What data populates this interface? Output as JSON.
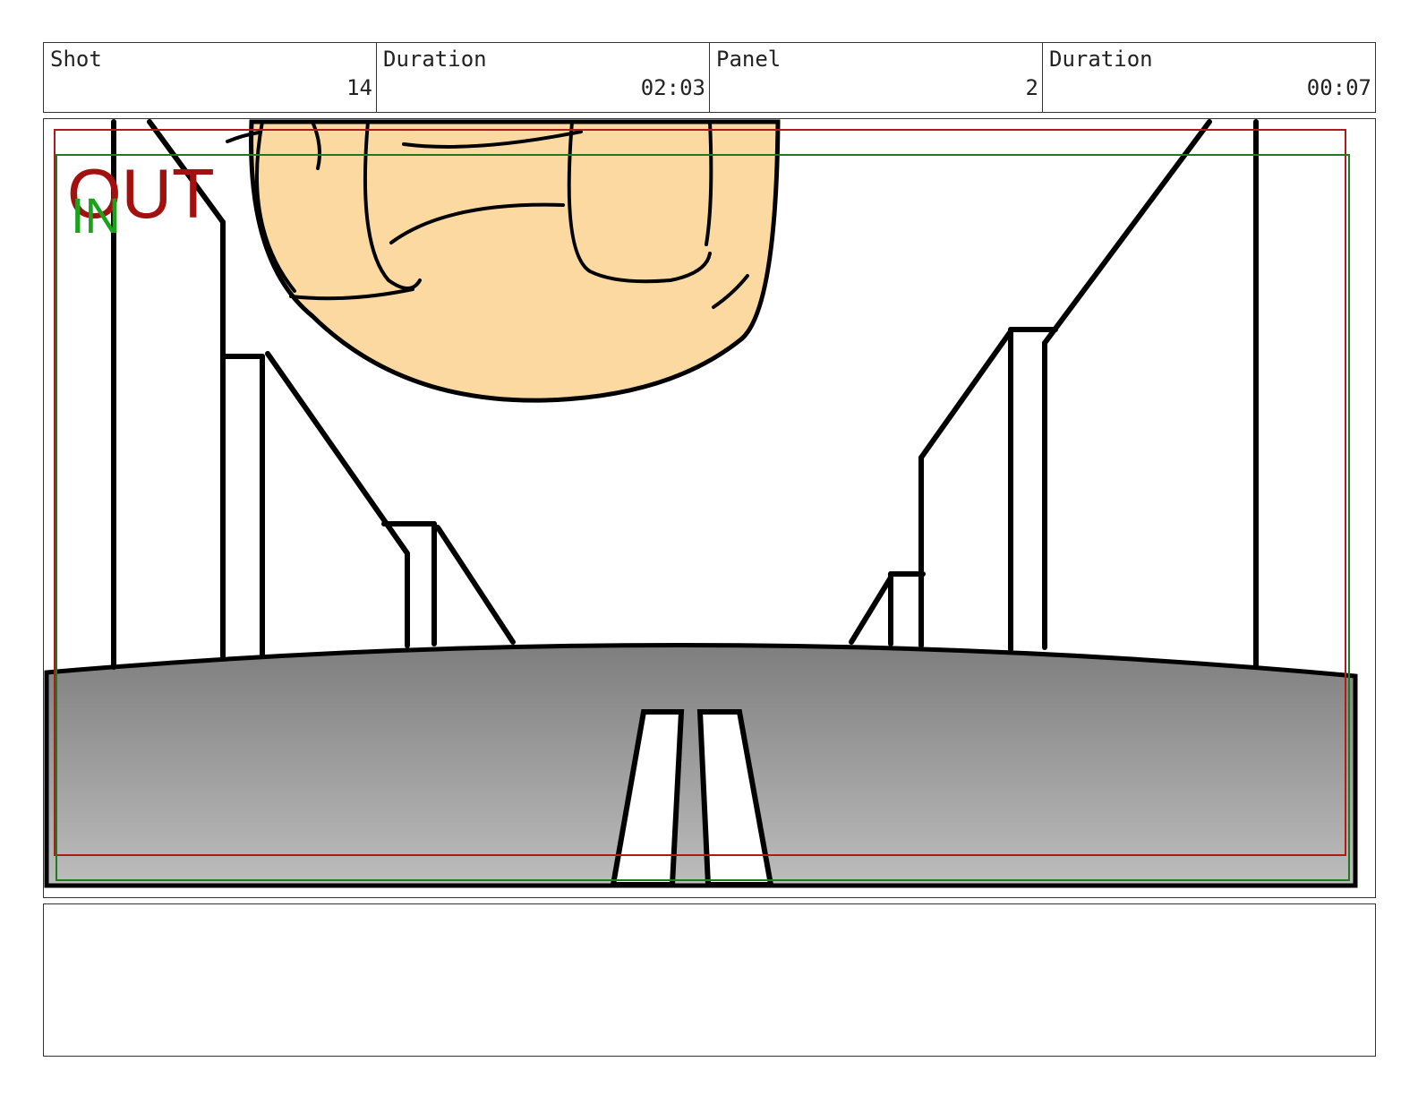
{
  "header": {
    "shot_label": "Shot",
    "shot_value": "14",
    "shot_duration_label": "Duration",
    "shot_duration_value": "02:03",
    "panel_label": "Panel",
    "panel_value": "2",
    "panel_duration_label": "Duration",
    "panel_duration_value": "00:07"
  },
  "panel": {
    "out_label": "OUT",
    "in_label": "IN",
    "colors": {
      "out_frame": "#b11a1a",
      "in_frame": "#1e7a1e",
      "skin": "#fcd9a0",
      "ground_top": "#7e7e7e",
      "ground_bottom": "#bdbdbd"
    }
  },
  "notes": {
    "text": ""
  }
}
